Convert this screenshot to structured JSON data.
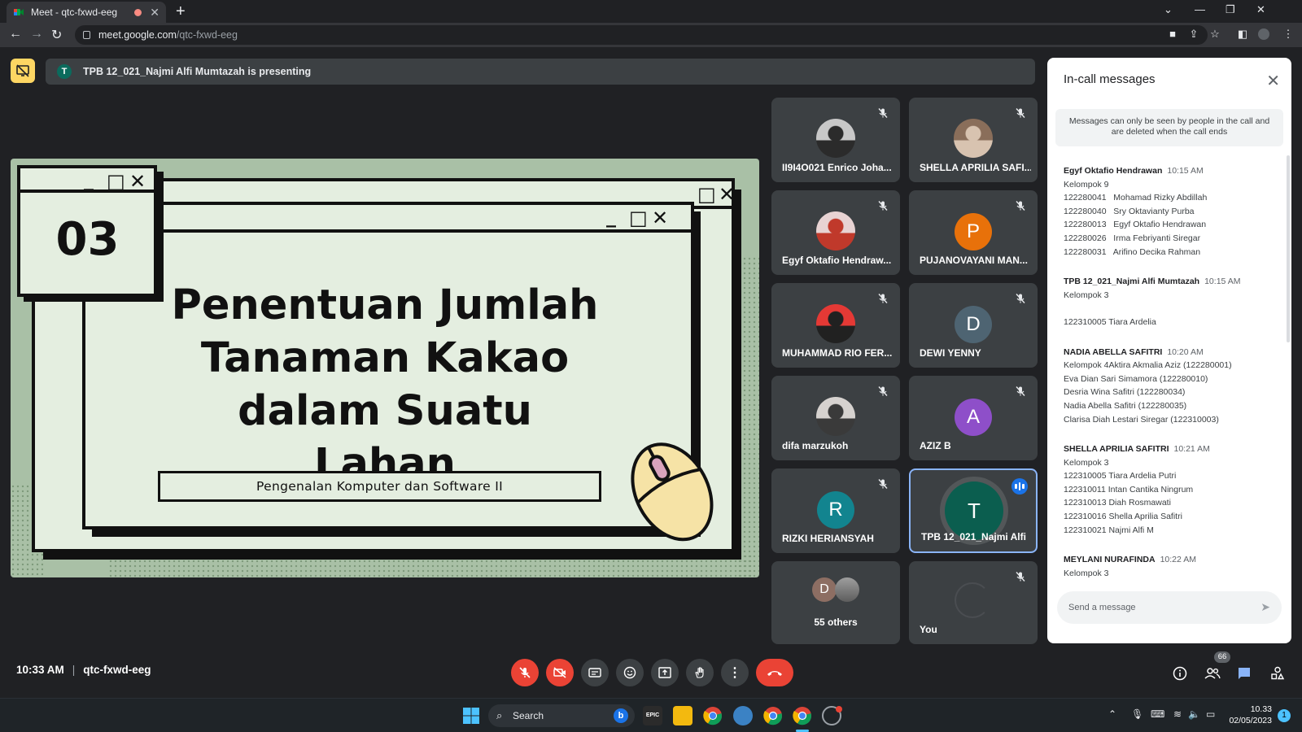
{
  "browser": {
    "tab_title": "Meet - qtc-fxwd-eeg",
    "url_domain": "meet.google.com",
    "url_path": "/qtc-fxwd-eeg"
  },
  "presenting_banner": {
    "avatar_letter": "T",
    "text": "TPB 12_021_Najmi Alfi Mumtazah is presenting"
  },
  "slide": {
    "number": "03",
    "title_lines": [
      "Penentuan Jumlah",
      "Tanaman Kakao",
      "dalam Suatu Lahan"
    ],
    "subtitle": "Pengenalan Komputer dan Software II"
  },
  "participants": [
    {
      "name": "II9I4O021 Enrico Joha...",
      "type": "photo",
      "muted": true
    },
    {
      "name": "SHELLA APRILIA SAFI...",
      "type": "photo",
      "muted": true
    },
    {
      "name": "Egyf Oktafio Hendraw...",
      "type": "photo",
      "muted": true
    },
    {
      "name": "PUJANOVAYANI MAN...",
      "type": "letter",
      "letter": "P",
      "color": "#e8710a",
      "muted": true
    },
    {
      "name": "MUHAMMAD RIO FER...",
      "type": "photo",
      "muted": true
    },
    {
      "name": "DEWI YENNY",
      "type": "letter",
      "letter": "D",
      "color": "#4e6472",
      "muted": true
    },
    {
      "name": "difa marzukoh",
      "type": "photo",
      "muted": true
    },
    {
      "name": "AZIZ B",
      "type": "letter",
      "letter": "A",
      "color": "#8e4fc9",
      "muted": true
    },
    {
      "name": "RIZKI HERIANSYAH",
      "type": "letter",
      "letter": "R",
      "color": "#12848f",
      "muted": true
    },
    {
      "name": "TPB 12_021_Najmi Alfi ...",
      "type": "letter",
      "letter": "T",
      "color": "#0b5e4f",
      "speaking": true
    },
    {
      "name": "55 others",
      "type": "others",
      "letter": "D"
    },
    {
      "name": "You",
      "type": "self",
      "muted": true
    }
  ],
  "chat": {
    "title": "In-call messages",
    "notice": "Messages can only be seen by people in the call and are deleted when the call ends",
    "input_placeholder": "Send a message",
    "messages": [
      {
        "sender": "Egyf Oktafio Hendrawan",
        "time": "10:15 AM",
        "lines": [
          "Kelompok 9",
          "122280041   Mohamad Rizky Abdillah",
          "122280040   Sry Oktavianty Purba",
          "122280013   Egyf Oktafio Hendrawan",
          "122280026   Irma Febriyanti Siregar",
          "122280031   Arifino Decika Rahman"
        ]
      },
      {
        "sender": "TPB 12_021_Najmi Alfi Mumtazah",
        "time": "10:15 AM",
        "lines": [
          "Kelompok 3",
          "",
          "122310005 Tiara Ardelia"
        ]
      },
      {
        "sender": "NADIA ABELLA SAFITRI",
        "time": "10:20 AM",
        "lines": [
          "Kelompok 4Aktira Akmalia Aziz (122280001)",
          "Eva Dian Sari Simamora (122280010)",
          "Desria Wina Safitri (122280034)",
          "Nadia Abella Safitri (122280035)",
          "Clarisa Diah Lestari Siregar (122310003)"
        ]
      },
      {
        "sender": "SHELLA APRILIA SAFITRI",
        "time": "10:21 AM",
        "lines": [
          "Kelompok 3",
          "122310005 Tiara Ardelia Putri",
          "122310011 Intan Cantika Ningrum",
          "122310013 Diah Rosmawati",
          "122310016 Shella Aprilia Safitri",
          "122310021 Najmi Alfi M"
        ]
      },
      {
        "sender": "MEYLANI NURAFINDA",
        "time": "10:22 AM",
        "lines": [
          "Kelompok 3"
        ]
      }
    ]
  },
  "meeting": {
    "time": "10:33 AM",
    "code": "qtc-fxwd-eeg",
    "people_count": "66"
  },
  "taskbar": {
    "search_label": "Search",
    "clock_time": "10.33",
    "clock_date": "02/05/2023",
    "notification_count": "1"
  }
}
